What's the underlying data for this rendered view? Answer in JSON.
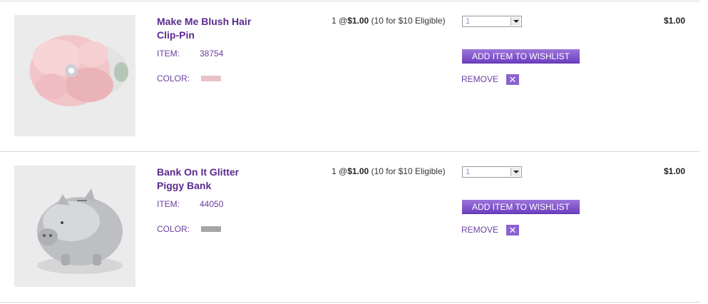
{
  "cart": {
    "items": [
      {
        "title_line1": "Make Me Blush Hair",
        "title_line2": "Clip-Pin",
        "item_label": "ITEM:",
        "item_number": "38754",
        "color_label": "COLOR:",
        "color_swatch": "#e7c2c6",
        "qty_prefix": "1 @",
        "price": "$1.00",
        "deal": "(10 for $10 Eligible)",
        "quantity": "1",
        "wishlist_label": "ADD ITEM TO WISHLIST",
        "remove_label": "REMOVE",
        "remove_icon": "✕",
        "total": "$1.00"
      },
      {
        "title_line1": "Bank On It Glitter",
        "title_line2": "Piggy Bank",
        "item_label": "ITEM:",
        "item_number": "44050",
        "color_label": "COLOR:",
        "color_swatch": "#a6a6a6",
        "qty_prefix": "1 @",
        "price": "$1.00",
        "deal": "(10 for $10 Eligible)",
        "quantity": "1",
        "wishlist_label": "ADD ITEM TO WISHLIST",
        "remove_label": "REMOVE",
        "remove_icon": "✕",
        "total": "$1.00"
      }
    ]
  },
  "colors": {
    "brand_purple": "#6a3fa1",
    "button_purple": "#7b4dc8"
  }
}
